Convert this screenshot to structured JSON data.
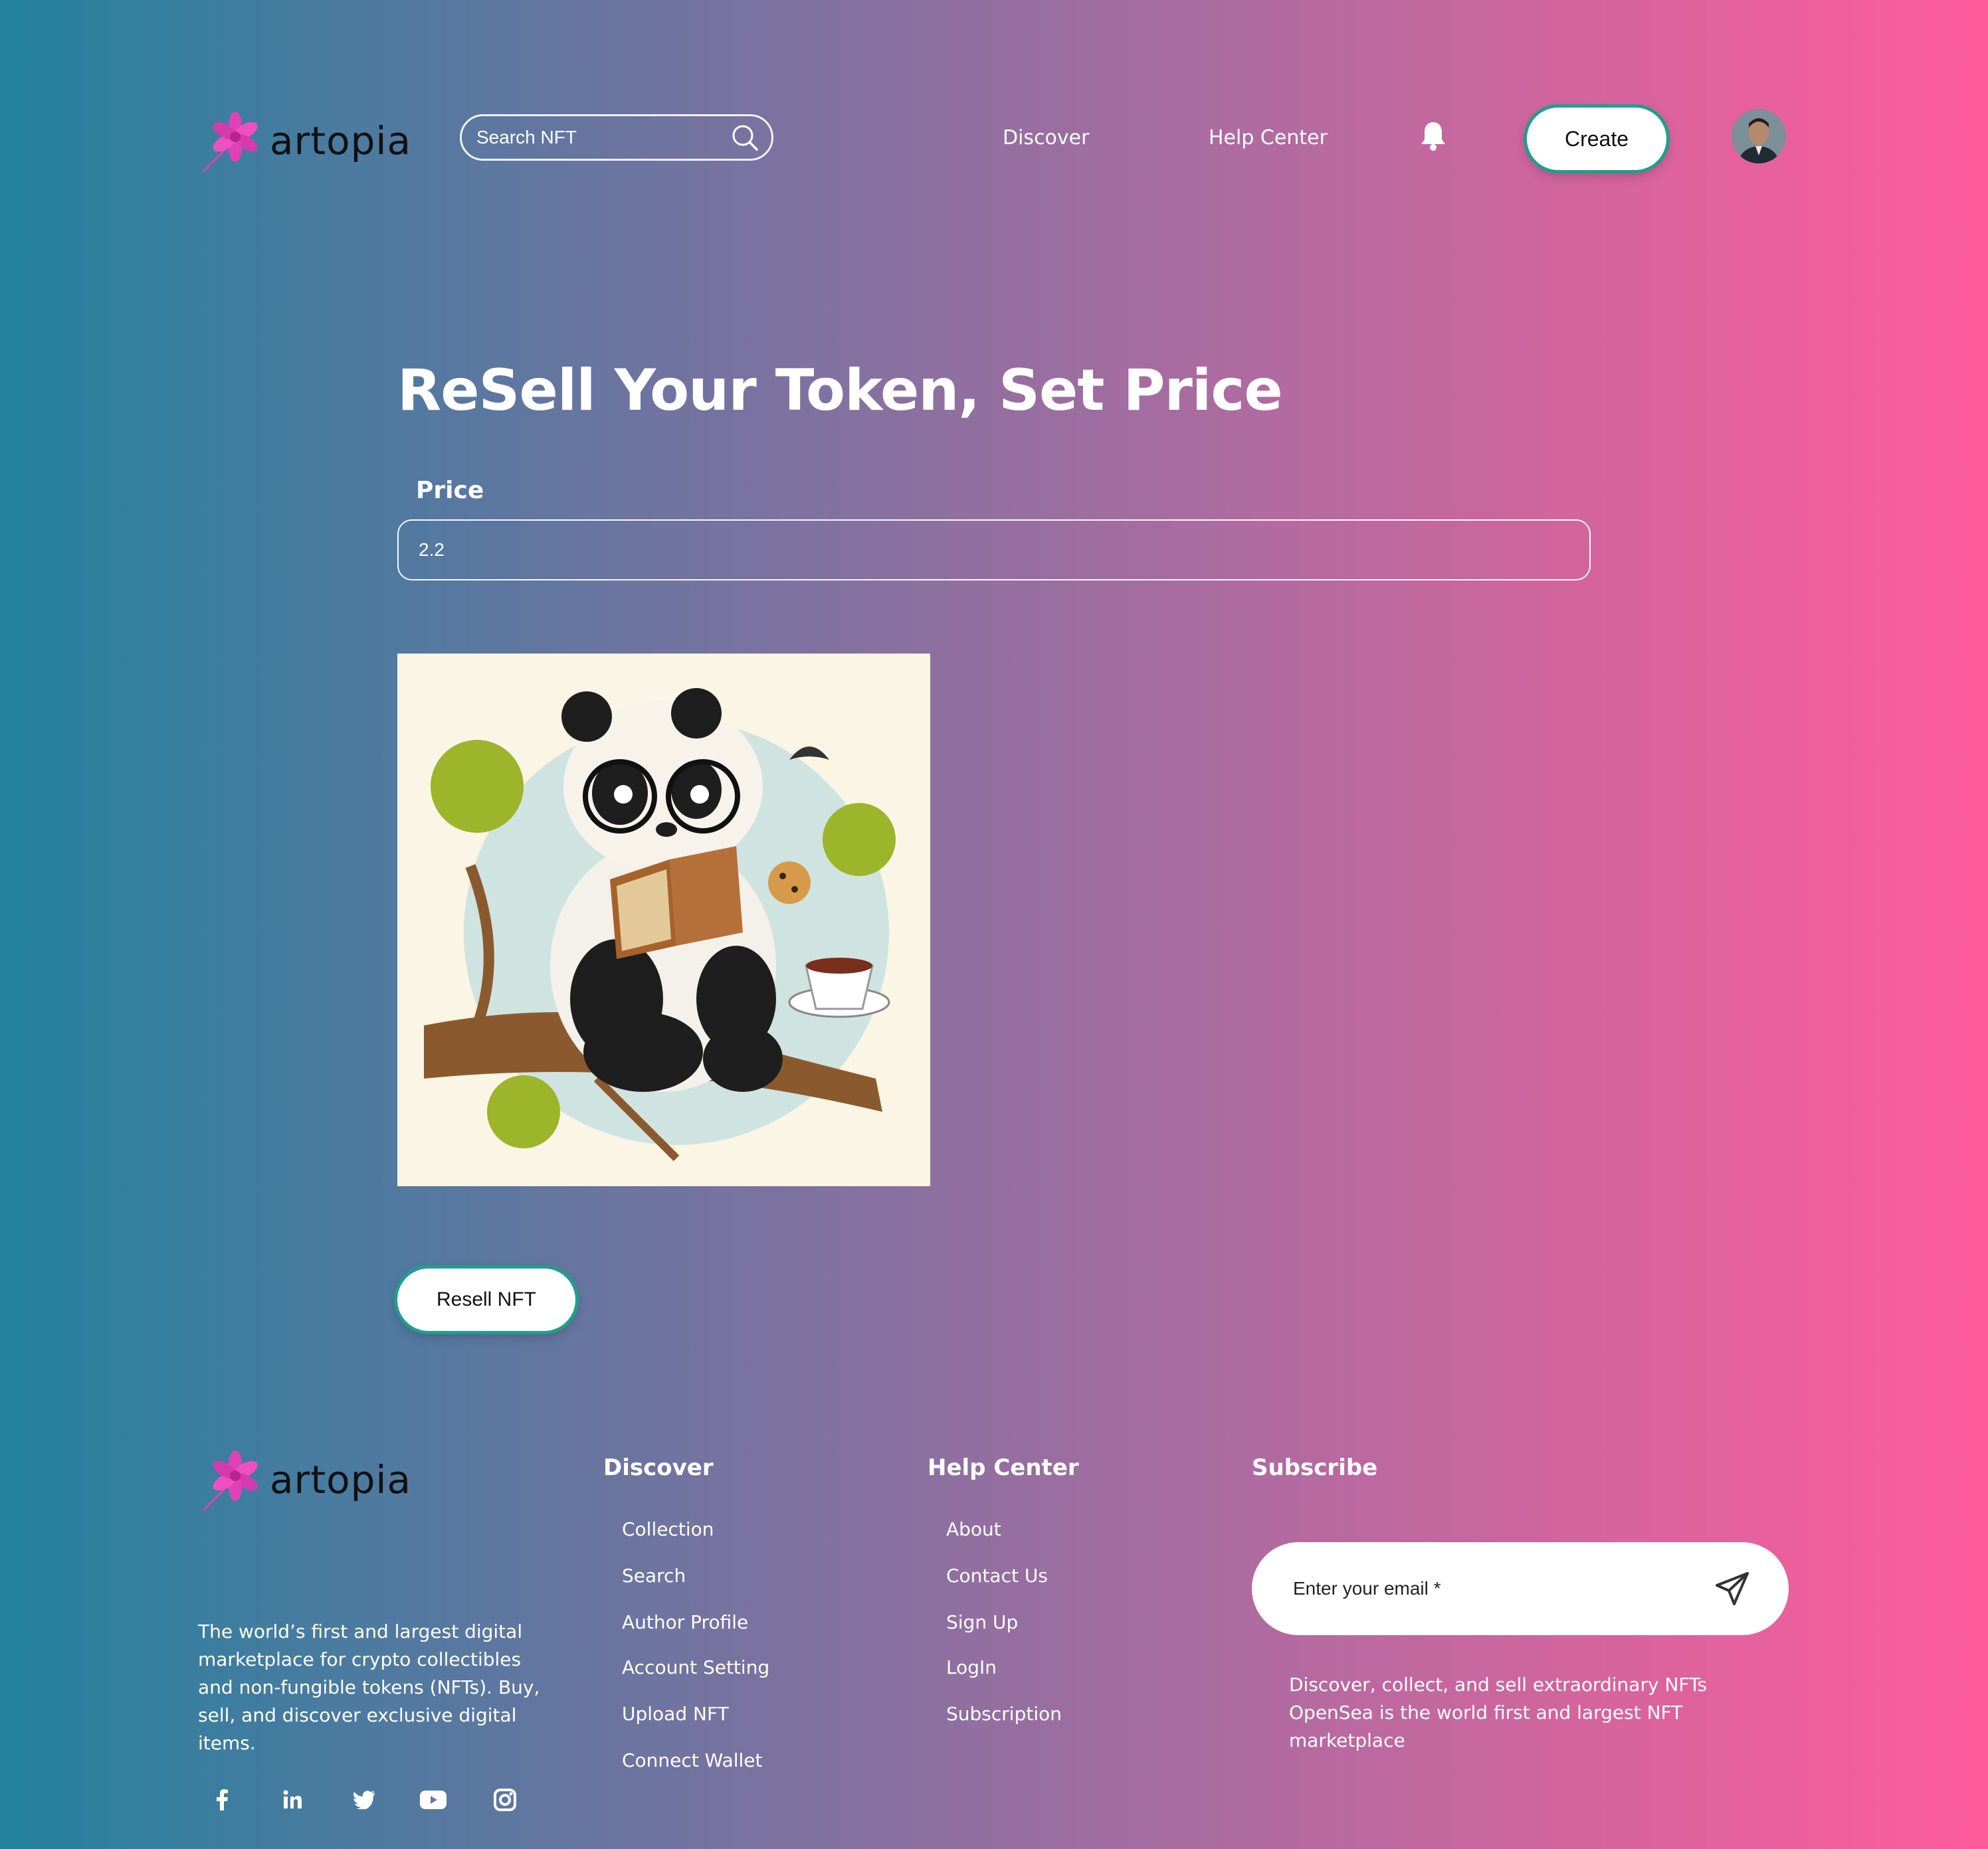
{
  "header": {
    "brand": "artopia",
    "search_placeholder": "Search NFT",
    "nav": [
      "Discover",
      "Help Center"
    ],
    "create_label": "Create"
  },
  "main": {
    "title": "ReSell Your Token, Set Price",
    "price_label": "Price",
    "price_value": "2.2",
    "resell_label": "Resell NFT"
  },
  "footer": {
    "brand": "artopia",
    "description": "The world’s first and largest digital marketplace for crypto collectibles and non-fungible tokens (NFTs). Buy, sell, and discover exclusive digital items.",
    "discover": {
      "heading": "Discover",
      "links": [
        "Collection",
        "Search",
        "Author Profile",
        "Account Setting",
        "Upload NFT",
        "Connect Wallet"
      ]
    },
    "help": {
      "heading": "Help Center",
      "links": [
        "About",
        "Contact Us",
        "Sign Up",
        "LogIn",
        "Subscription"
      ]
    },
    "subscribe": {
      "heading": "Subscribe",
      "email_placeholder": "Enter your email *",
      "description": "Discover, collect, and sell extraordinary NFTs OpenSea is the world first and largest NFT marketplace"
    },
    "social_icons": [
      "facebook-icon",
      "linkedin-icon",
      "twitter-icon",
      "youtube-icon",
      "instagram-icon"
    ]
  },
  "colors": {
    "gradient_left": "#23829f",
    "gradient_right": "#ff5c9b",
    "button_glow": "#1f9f8e",
    "logo_pink": "#e040b8"
  }
}
